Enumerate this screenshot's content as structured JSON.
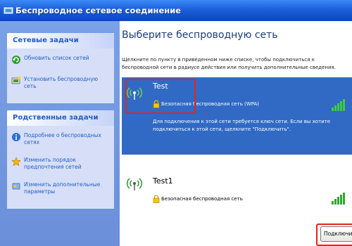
{
  "window": {
    "title": "Беспроводное сетевое соединение"
  },
  "sidebar": {
    "network_tasks": {
      "header": "Сетевые задачи",
      "items": [
        {
          "label": "Обновить список сетей",
          "icon": "refresh-icon"
        },
        {
          "label": "Установить беспроводную сеть",
          "icon": "setup-network-icon"
        }
      ]
    },
    "related_tasks": {
      "header": "Родственные задачи",
      "items": [
        {
          "label": "Подробнее о беспроводных сетях",
          "icon": "info-icon"
        },
        {
          "label": "Изменить порядок предпочтения сетей",
          "icon": "star-icon"
        },
        {
          "label": "Изменить дополнительные параметры",
          "icon": "settings-icon"
        }
      ]
    }
  },
  "main": {
    "title": "Выберите беспроводную сеть",
    "description": "Щелкните по пункту в приведенном ниже списке, чтобы подключиться к беспроводной сети в радиусе действия или получить дополнительные сведения.",
    "networks": [
      {
        "name": "Test",
        "security": "Безопасная беспроводная сеть (WPA)",
        "detail": "Для подключения к этой сети требуется ключ сети. Если вы хотите подключиться к этой сети, щелкните \"Подключить\".",
        "selected": true,
        "signal_bars": 5
      },
      {
        "name": "Test1",
        "security": "Безопасная беспроводная сеть",
        "selected": false,
        "signal_bars": 5
      }
    ],
    "connect_label": "Подключить"
  },
  "colors": {
    "titlebar": "#1c5fd8",
    "selection": "#316ac5",
    "highlight_box": "#e0261b",
    "task_text": "#215dc6"
  }
}
